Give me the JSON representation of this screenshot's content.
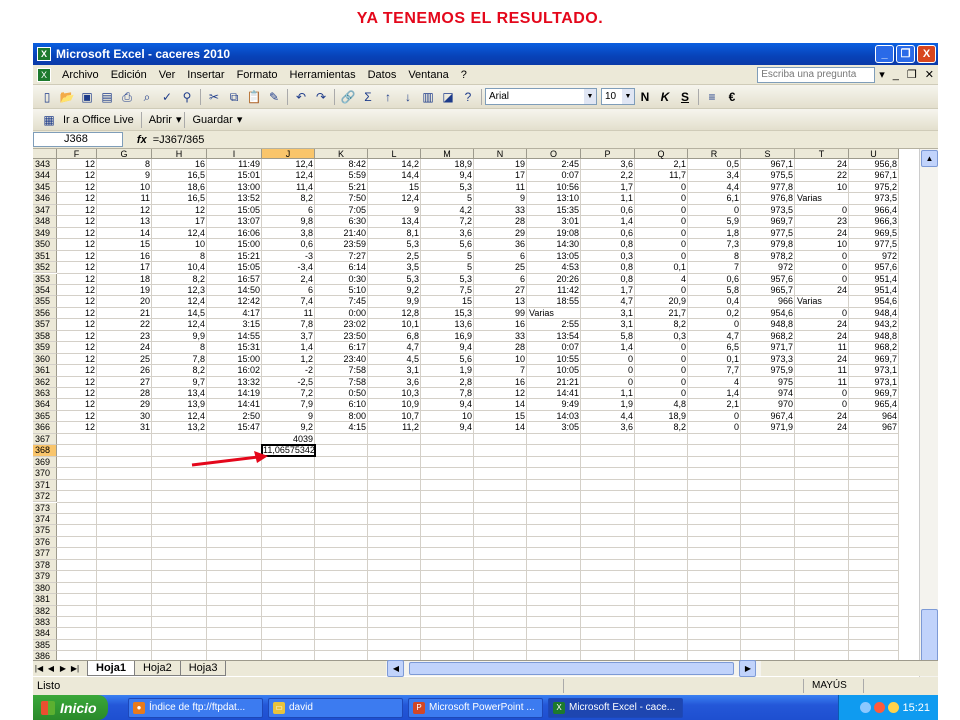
{
  "slide_title": "YA TENEMOS EL RESULTADO.",
  "window": {
    "title": "Microsoft Excel - caceres 2010",
    "controls": [
      "_",
      "❐",
      "X"
    ]
  },
  "menu": {
    "items": [
      "Archivo",
      "Edición",
      "Ver",
      "Insertar",
      "Formato",
      "Herramientas",
      "Datos",
      "Ventana",
      "?"
    ],
    "ask_placeholder": "Escriba una pregunta"
  },
  "toolbar": {
    "font": "Arial",
    "size": "10",
    "bold": "N",
    "italic": "K",
    "underline": "S",
    "currency": "€",
    "sum": "Σ"
  },
  "toolbar2": {
    "office_live": "Ir a Office Live",
    "open": "Abrir",
    "save": "Guardar"
  },
  "formula_bar": {
    "name_box": "J368",
    "fx": "fx",
    "formula": "=J367/365"
  },
  "columns": [
    "F",
    "G",
    "H",
    "I",
    "J",
    "K",
    "L",
    "M",
    "N",
    "O",
    "P",
    "Q",
    "R",
    "S",
    "T",
    "U"
  ],
  "selected_column": "J",
  "rows": [
    {
      "n": "343",
      "c": [
        "12",
        "8",
        "16",
        "11:49",
        "12,4",
        "8:42",
        "14,2",
        "18,9",
        "19",
        "2:45",
        "3,6",
        "2,1",
        "0,5",
        "967,1",
        "24",
        "956,8"
      ]
    },
    {
      "n": "344",
      "c": [
        "12",
        "9",
        "16,5",
        "15:01",
        "12,4",
        "5:59",
        "14,4",
        "9,4",
        "17",
        "0:07",
        "2,2",
        "11,7",
        "3,4",
        "975,5",
        "22",
        "967,1"
      ]
    },
    {
      "n": "345",
      "c": [
        "12",
        "10",
        "18,6",
        "13:00",
        "11,4",
        "5:21",
        "15",
        "5,3",
        "11",
        "10:56",
        "1,7",
        "0",
        "4,4",
        "977,8",
        "10",
        "975,2"
      ]
    },
    {
      "n": "346",
      "c": [
        "12",
        "11",
        "16,5",
        "13:52",
        "8,2",
        "7:50",
        "12,4",
        "5",
        "9",
        "13:10",
        "1,1",
        "0",
        "6,1",
        "976,8",
        "Varias",
        "973,5"
      ]
    },
    {
      "n": "347",
      "c": [
        "12",
        "12",
        "12",
        "15:05",
        "6",
        "7:05",
        "9",
        "4,2",
        "33",
        "15:35",
        "0,6",
        "0",
        "0",
        "973,5",
        "0",
        "966,4"
      ]
    },
    {
      "n": "348",
      "c": [
        "12",
        "13",
        "17",
        "13:07",
        "9,8",
        "6:30",
        "13,4",
        "7,2",
        "28",
        "3:01",
        "1,4",
        "0",
        "5,9",
        "969,7",
        "23",
        "966,3"
      ]
    },
    {
      "n": "349",
      "c": [
        "12",
        "14",
        "12,4",
        "16:06",
        "3,8",
        "21:40",
        "8,1",
        "3,6",
        "29",
        "19:08",
        "0,6",
        "0",
        "1,8",
        "977,5",
        "24",
        "969,5"
      ]
    },
    {
      "n": "350",
      "c": [
        "12",
        "15",
        "10",
        "15:00",
        "0,6",
        "23:59",
        "5,3",
        "5,6",
        "36",
        "14:30",
        "0,8",
        "0",
        "7,3",
        "979,8",
        "10",
        "977,5"
      ]
    },
    {
      "n": "351",
      "c": [
        "12",
        "16",
        "8",
        "15:21",
        "-3",
        "7:27",
        "2,5",
        "5",
        "6",
        "13:05",
        "0,3",
        "0",
        "8",
        "978,2",
        "0",
        "972"
      ]
    },
    {
      "n": "352",
      "c": [
        "12",
        "17",
        "10,4",
        "15:05",
        "-3,4",
        "6:14",
        "3,5",
        "5",
        "25",
        "4:53",
        "0,8",
        "0,1",
        "7",
        "972",
        "0",
        "957,6"
      ]
    },
    {
      "n": "353",
      "c": [
        "12",
        "18",
        "8,2",
        "16:57",
        "2,4",
        "0:30",
        "5,3",
        "5,3",
        "6",
        "20:26",
        "0,8",
        "4",
        "0,6",
        "957,6",
        "0",
        "951,4"
      ]
    },
    {
      "n": "354",
      "c": [
        "12",
        "19",
        "12,3",
        "14:50",
        "6",
        "5:10",
        "9,2",
        "7,5",
        "27",
        "11:42",
        "1,7",
        "0",
        "5,8",
        "965,7",
        "24",
        "951,4"
      ]
    },
    {
      "n": "355",
      "c": [
        "12",
        "20",
        "12,4",
        "12:42",
        "7,4",
        "7:45",
        "9,9",
        "15",
        "13",
        "18:55",
        "4,7",
        "20,9",
        "0,4",
        "966",
        "Varias",
        "954,6"
      ]
    },
    {
      "n": "356",
      "c": [
        "12",
        "21",
        "14,5",
        "4:17",
        "11",
        "0:00",
        "12,8",
        "15,3",
        "99",
        "Varias",
        "3,1",
        "21,7",
        "0,2",
        "954,6",
        "0",
        "948,4"
      ]
    },
    {
      "n": "357",
      "c": [
        "12",
        "22",
        "12,4",
        "3:15",
        "7,8",
        "23:02",
        "10,1",
        "13,6",
        "16",
        "2:55",
        "3,1",
        "8,2",
        "0",
        "948,8",
        "24",
        "943,2"
      ]
    },
    {
      "n": "358",
      "c": [
        "12",
        "23",
        "9,9",
        "14:55",
        "3,7",
        "23:50",
        "6,8",
        "16,9",
        "33",
        "13:54",
        "5,8",
        "0,3",
        "4,7",
        "968,2",
        "24",
        "948,8"
      ]
    },
    {
      "n": "359",
      "c": [
        "12",
        "24",
        "8",
        "15:31",
        "1,4",
        "6:17",
        "4,7",
        "9,4",
        "28",
        "0:07",
        "1,4",
        "0",
        "6,5",
        "971,7",
        "11",
        "968,2"
      ]
    },
    {
      "n": "360",
      "c": [
        "12",
        "25",
        "7,8",
        "15:00",
        "1,2",
        "23:40",
        "4,5",
        "5,6",
        "10",
        "10:55",
        "0",
        "0",
        "0,1",
        "973,3",
        "24",
        "969,7"
      ]
    },
    {
      "n": "361",
      "c": [
        "12",
        "26",
        "8,2",
        "16:02",
        "-2",
        "7:58",
        "3,1",
        "1,9",
        "7",
        "10:05",
        "0",
        "0",
        "7,7",
        "975,9",
        "11",
        "973,1"
      ]
    },
    {
      "n": "362",
      "c": [
        "12",
        "27",
        "9,7",
        "13:32",
        "-2,5",
        "7:58",
        "3,6",
        "2,8",
        "16",
        "21:21",
        "0",
        "0",
        "4",
        "975",
        "11",
        "973,1"
      ]
    },
    {
      "n": "363",
      "c": [
        "12",
        "28",
        "13,4",
        "14:19",
        "7,2",
        "0:50",
        "10,3",
        "7,8",
        "12",
        "14:41",
        "1,1",
        "0",
        "1,4",
        "974",
        "0",
        "969,7"
      ]
    },
    {
      "n": "364",
      "c": [
        "12",
        "29",
        "13,9",
        "14:41",
        "7,9",
        "6:10",
        "10,9",
        "9,4",
        "14",
        "9:49",
        "1,9",
        "4,8",
        "2,1",
        "970",
        "0",
        "965,4"
      ]
    },
    {
      "n": "365",
      "c": [
        "12",
        "30",
        "12,4",
        "2:50",
        "9",
        "8:00",
        "10,7",
        "10",
        "15",
        "14:03",
        "4,4",
        "18,9",
        "0",
        "967,4",
        "24",
        "964"
      ]
    },
    {
      "n": "366",
      "c": [
        "12",
        "31",
        "13,2",
        "15:47",
        "9,2",
        "4:15",
        "11,2",
        "9,4",
        "14",
        "3:05",
        "3,6",
        "8,2",
        "0",
        "971,9",
        "24",
        "967"
      ]
    },
    {
      "n": "367",
      "c": [
        "",
        "",
        "",
        "",
        "4039",
        "",
        "",
        "",
        "",
        "",
        "",
        "",
        "",
        "",
        "",
        ""
      ]
    },
    {
      "n": "368",
      "c": [
        "",
        "",
        "",
        "",
        "11,06575342",
        "",
        "",
        "",
        "",
        "",
        "",
        "",
        "",
        "",
        "",
        ""
      ]
    }
  ],
  "empty_rows": [
    "369",
    "370",
    "371",
    "372",
    "373",
    "374",
    "375",
    "376",
    "377",
    "378",
    "379",
    "380",
    "381",
    "382",
    "383",
    "384",
    "385",
    "386"
  ],
  "sheets": [
    "Hoja1",
    "Hoja2",
    "Hoja3"
  ],
  "active_sheet": "Hoja1",
  "status": {
    "left": "Listo",
    "caps": "MAYÚS"
  },
  "taskbar": {
    "start": "Inicio",
    "tasks": [
      "Índice de ftp://ftpdat...",
      "david",
      "Microsoft PowerPoint ...",
      "Microsoft Excel - cace..."
    ],
    "clock": "15:21"
  },
  "colors": {
    "accent_red": "#e4071b",
    "selection": "#f9c56b",
    "xp_blue": "#0a5fe0"
  }
}
